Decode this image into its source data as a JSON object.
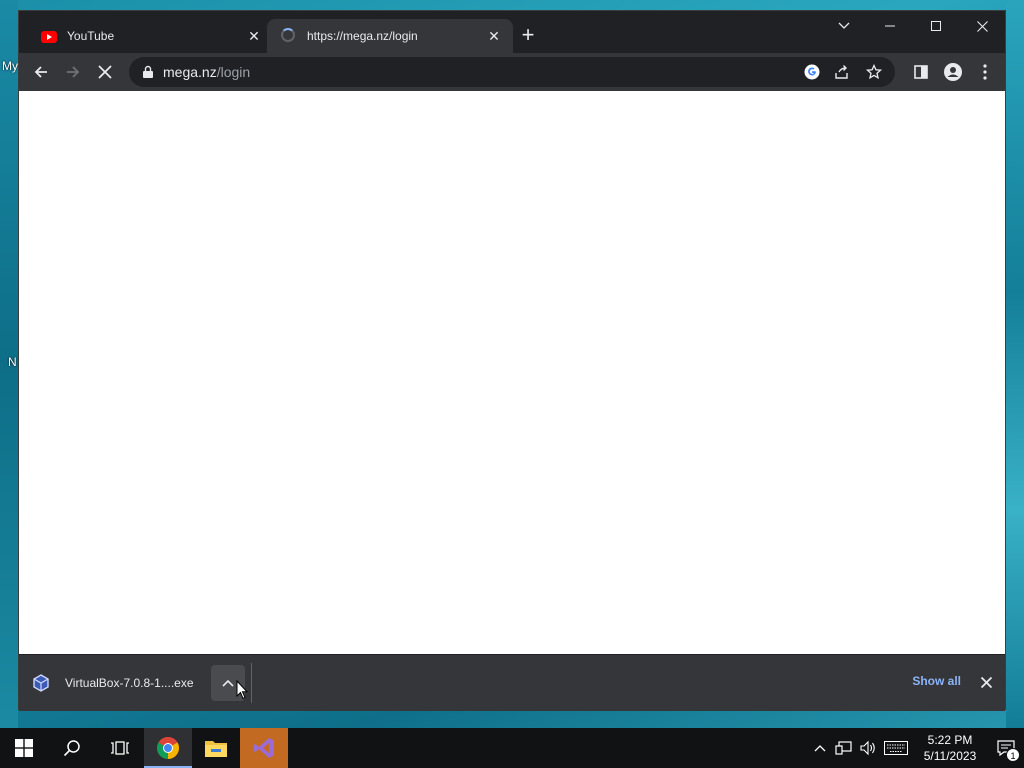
{
  "desktop": {
    "peek_labels": [
      "My",
      "N"
    ]
  },
  "browser": {
    "tabs": [
      {
        "title": "YouTube",
        "favicon": "youtube-icon",
        "active": false
      },
      {
        "title": "https://mega.nz/login",
        "favicon": "loading-spinner-icon",
        "active": true
      }
    ],
    "omnibox": {
      "host": "mega.nz",
      "path": "/login"
    },
    "downloads": {
      "file_name": "VirtualBox-7.0.8-1....exe",
      "show_all_label": "Show all"
    }
  },
  "taskbar": {
    "apps": [
      "start-icon",
      "search-icon",
      "task-view-icon",
      "chrome-icon",
      "file-explorer-icon",
      "visual-studio-icon"
    ],
    "clock": {
      "time": "5:22 PM",
      "date": "5/11/2023"
    },
    "notification_count": "1"
  },
  "colors": {
    "chrome_dark": "#202124",
    "chrome_toolbar": "#35363a",
    "accent_link": "#8ab4f8",
    "youtube_red": "#ff0000"
  }
}
